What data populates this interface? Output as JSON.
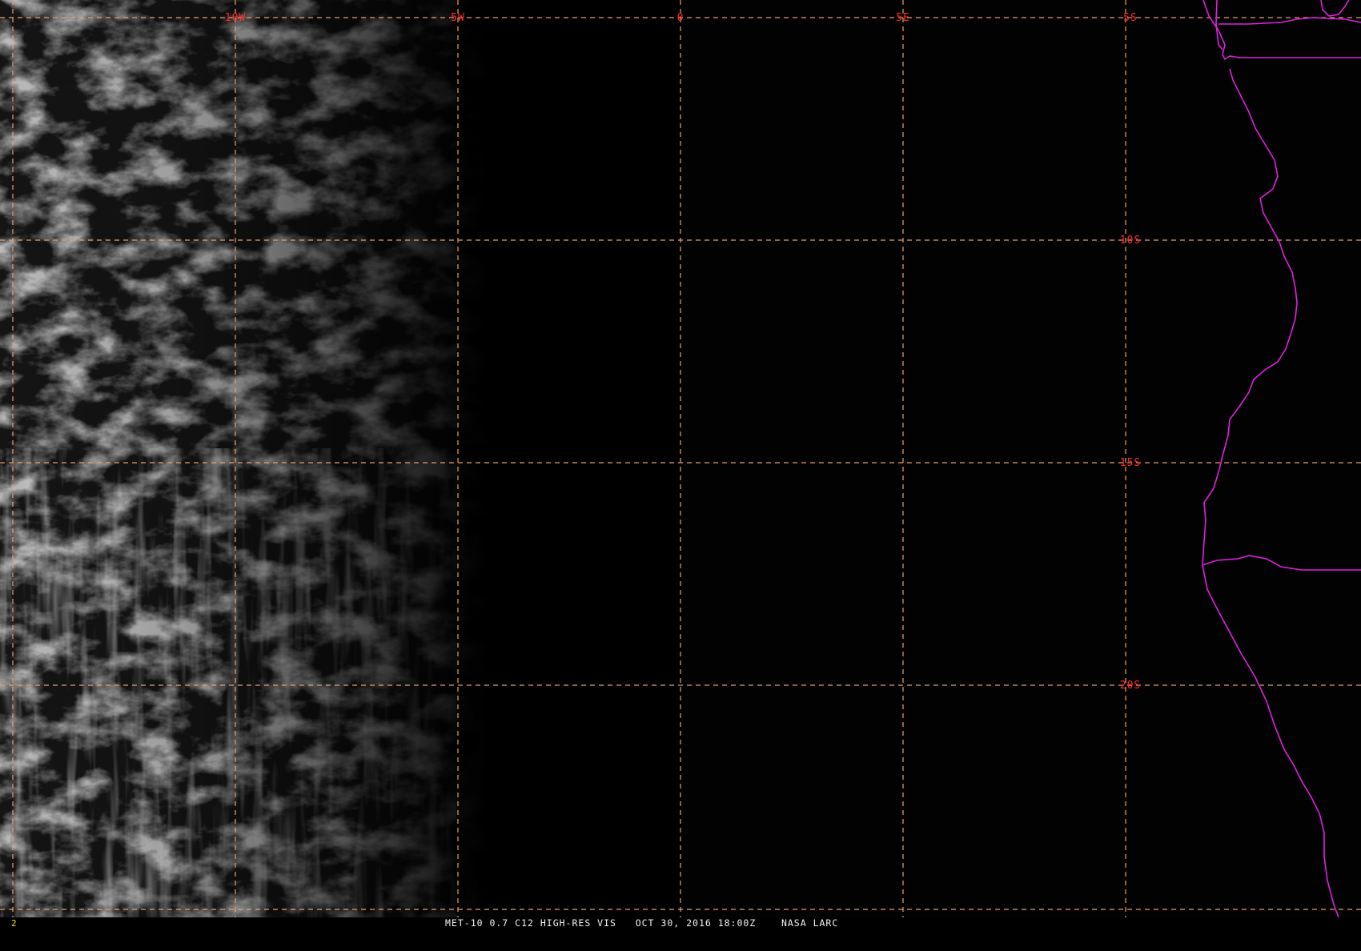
{
  "image": {
    "title": "MET-10 0.7 C12 HIGH-RES VIS   OCT 30, 2016 18:00Z    NASA LARC",
    "frame_number": "2"
  },
  "grid": {
    "longitude_labels": [
      "10W",
      "5W",
      "0",
      "5E"
    ],
    "latitude_labels": [
      "5S",
      "10S",
      "15S",
      "20S"
    ]
  },
  "colors": {
    "grid_line": "#e8a070",
    "grid_label": "#ff2a2a",
    "coastline": "#e020e0",
    "frame_number": "#f2e020",
    "footer_text": "#f2f2f2"
  }
}
